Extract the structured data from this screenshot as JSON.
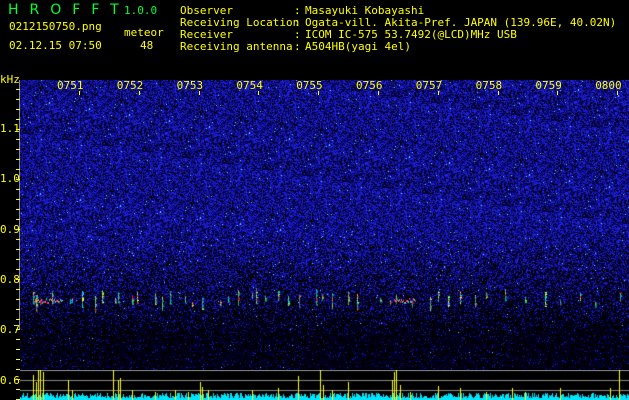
{
  "header": {
    "app_name": "HROFFT",
    "app_letters": [
      "H",
      "R",
      "O",
      "F",
      "F",
      "T"
    ],
    "version": "1.0.0",
    "filename": "0212150750.png",
    "datetime": "02.12.15 07:50",
    "meteor_label": "meteor",
    "meteor_count": "48"
  },
  "info": [
    {
      "label": "Observer",
      "value": "Masayuki Kobayashi"
    },
    {
      "label": "Receiving Location",
      "value": "Ogata-vill. Akita-Pref. JAPAN (139.96E, 40.02N)"
    },
    {
      "label": "Receiver",
      "value": "ICOM IC-575 53.7492(@LCD)MHz USB"
    },
    {
      "label": "Receiving antenna",
      "value": "A504HB(yagi 4el)"
    }
  ],
  "spectrogram": {
    "y_unit": "kHz",
    "y_ticks": [
      "1.1",
      "1.0",
      "0.9",
      "0.8",
      "0.7",
      "0.6"
    ],
    "x_ticks": [
      "0751",
      "0752",
      "0753",
      "0754",
      "0755",
      "0756",
      "0757",
      "0758",
      "0759",
      "0800"
    ],
    "colors": {
      "noise": "#1a1aff",
      "echo_hot": "#ff2040",
      "echo_mid": "#00ff80",
      "histogram_peak": "#ffff00",
      "histogram_base": "#00e5ff"
    }
  }
}
